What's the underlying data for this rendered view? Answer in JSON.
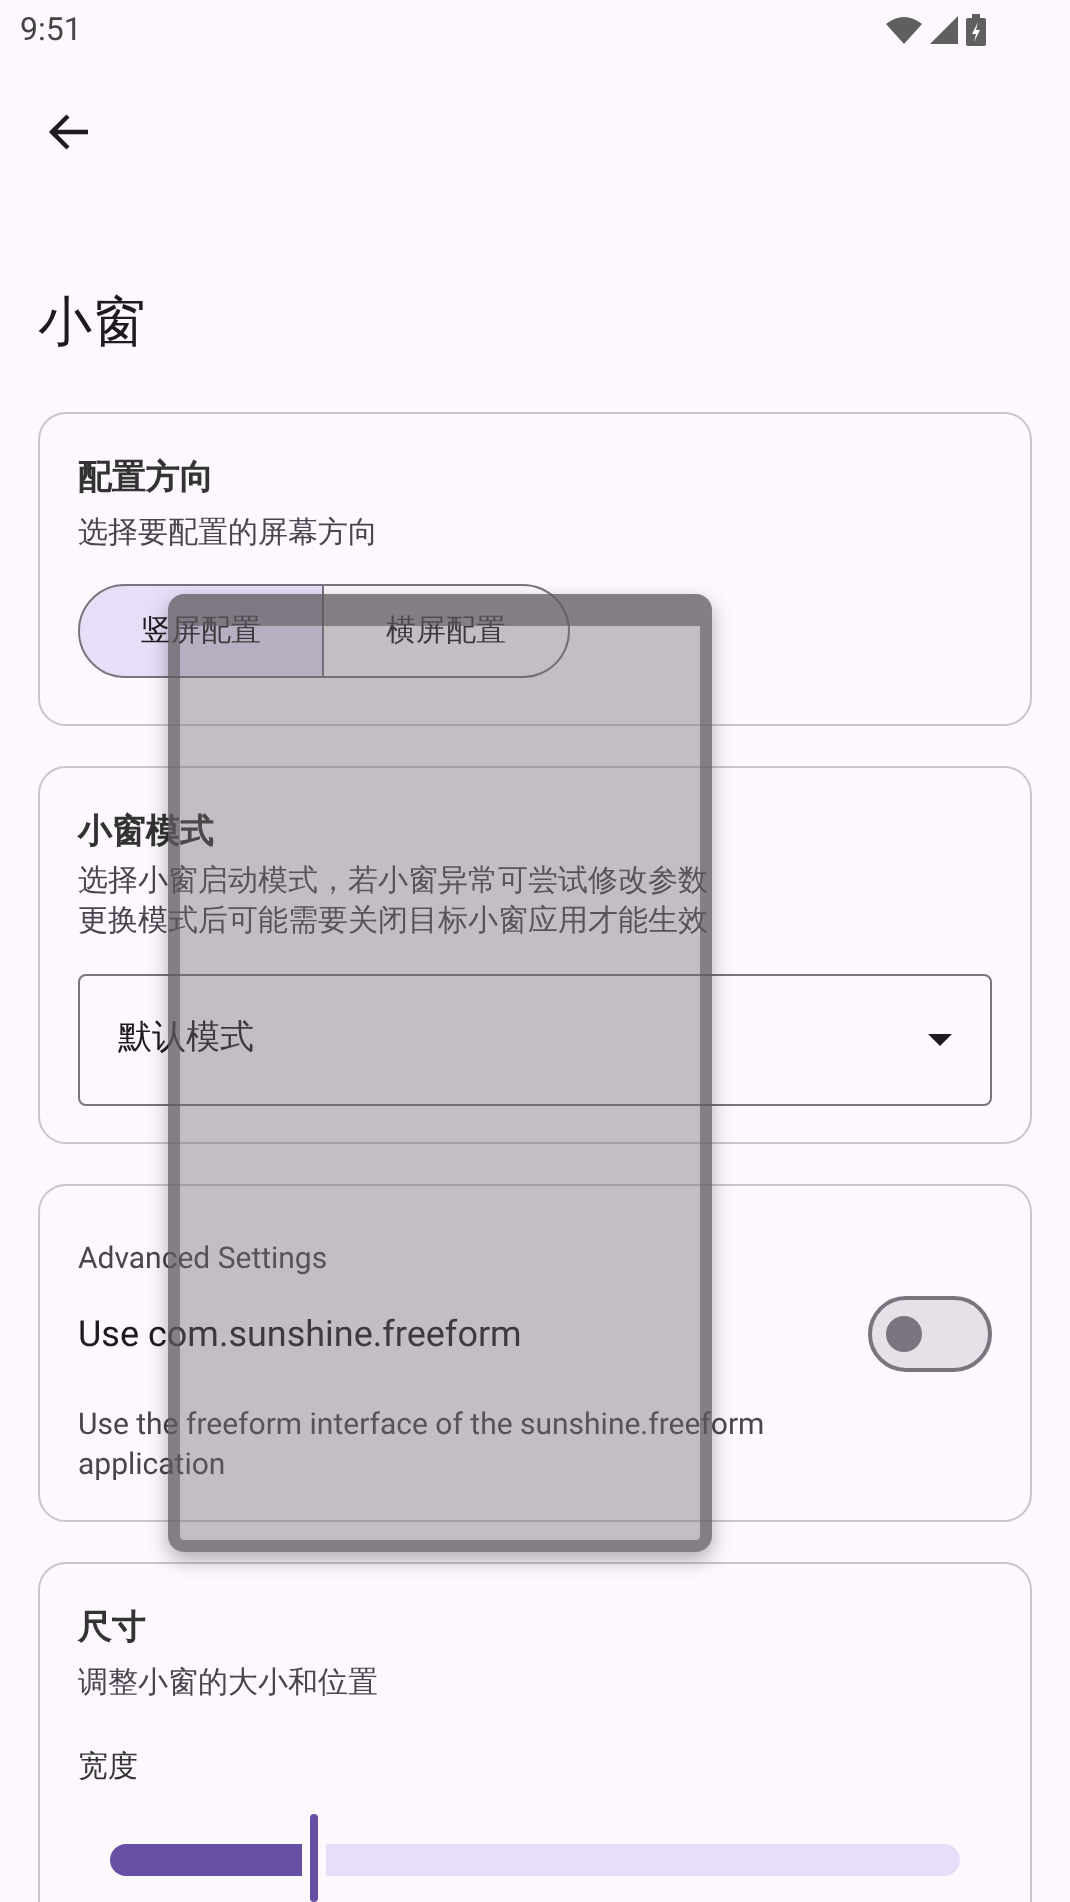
{
  "status_bar": {
    "time": "9:51"
  },
  "title": "小窗",
  "orientation_card": {
    "title": "配置方向",
    "subtitle": "选择要配置的屏幕方向",
    "options": [
      {
        "label": "竖屏配置",
        "selected": true
      },
      {
        "label": "横屏配置",
        "selected": false
      }
    ]
  },
  "mode_card": {
    "title": "小窗模式",
    "description": [
      "选择小窗启动模式，若小窗异常可尝试修改参数",
      "更换模式后可能需要关闭目标小窗应用才能生效"
    ],
    "dropdown": {
      "value": "默认模式"
    }
  },
  "advanced_card": {
    "section": "Advanced Settings",
    "toggle": {
      "label": "Use com.sunshine.freeform",
      "on": false
    },
    "description": "Use the freeform interface of the sunshine.freeform application"
  },
  "size_card": {
    "title": "尺寸",
    "subtitle": "调整小窗的大小和位置",
    "slider": {
      "label": "宽度",
      "level": 0.24
    }
  }
}
